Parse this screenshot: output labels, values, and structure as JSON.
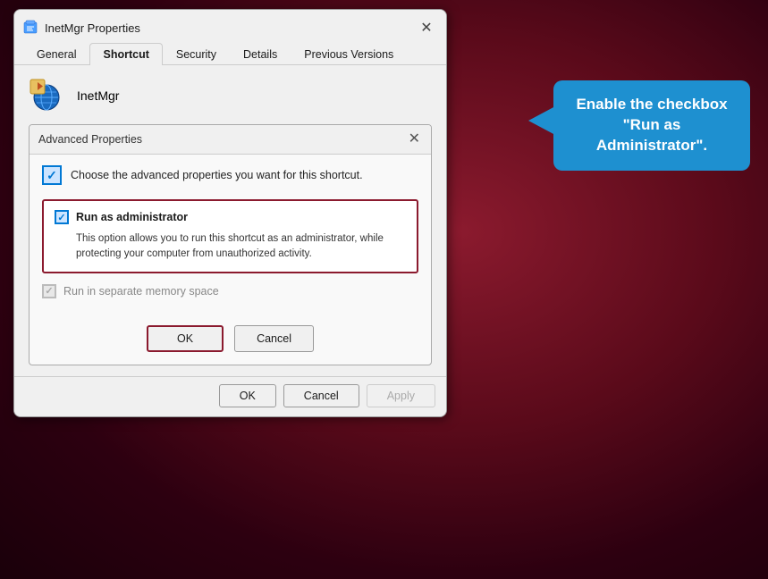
{
  "window": {
    "title": "InetMgr Properties",
    "close_label": "✕"
  },
  "tabs": [
    {
      "id": "general",
      "label": "General",
      "active": false
    },
    {
      "id": "shortcut",
      "label": "Shortcut",
      "active": true
    },
    {
      "id": "security",
      "label": "Security",
      "active": false
    },
    {
      "id": "details",
      "label": "Details",
      "active": false
    },
    {
      "id": "previous-versions",
      "label": "Previous Versions",
      "active": false
    }
  ],
  "file": {
    "name": "InetMgr"
  },
  "advanced_dialog": {
    "title": "Advanced Properties",
    "close_label": "✕",
    "header_text": "Choose the advanced properties you want for this shortcut.",
    "run_as_admin": {
      "label": "Run as administrator",
      "description": "This option allows you to run this shortcut as an administrator, while protecting your computer from unauthorized activity.",
      "checked": true
    },
    "run_separate_memory": {
      "label": "Run in separate memory space",
      "checked": true,
      "disabled": true
    },
    "ok_label": "OK",
    "cancel_label": "Cancel"
  },
  "bottom_buttons": {
    "ok_label": "OK",
    "cancel_label": "Cancel",
    "apply_label": "Apply"
  },
  "callout": {
    "text": "Enable the checkbox \"Run as Administrator\"."
  }
}
